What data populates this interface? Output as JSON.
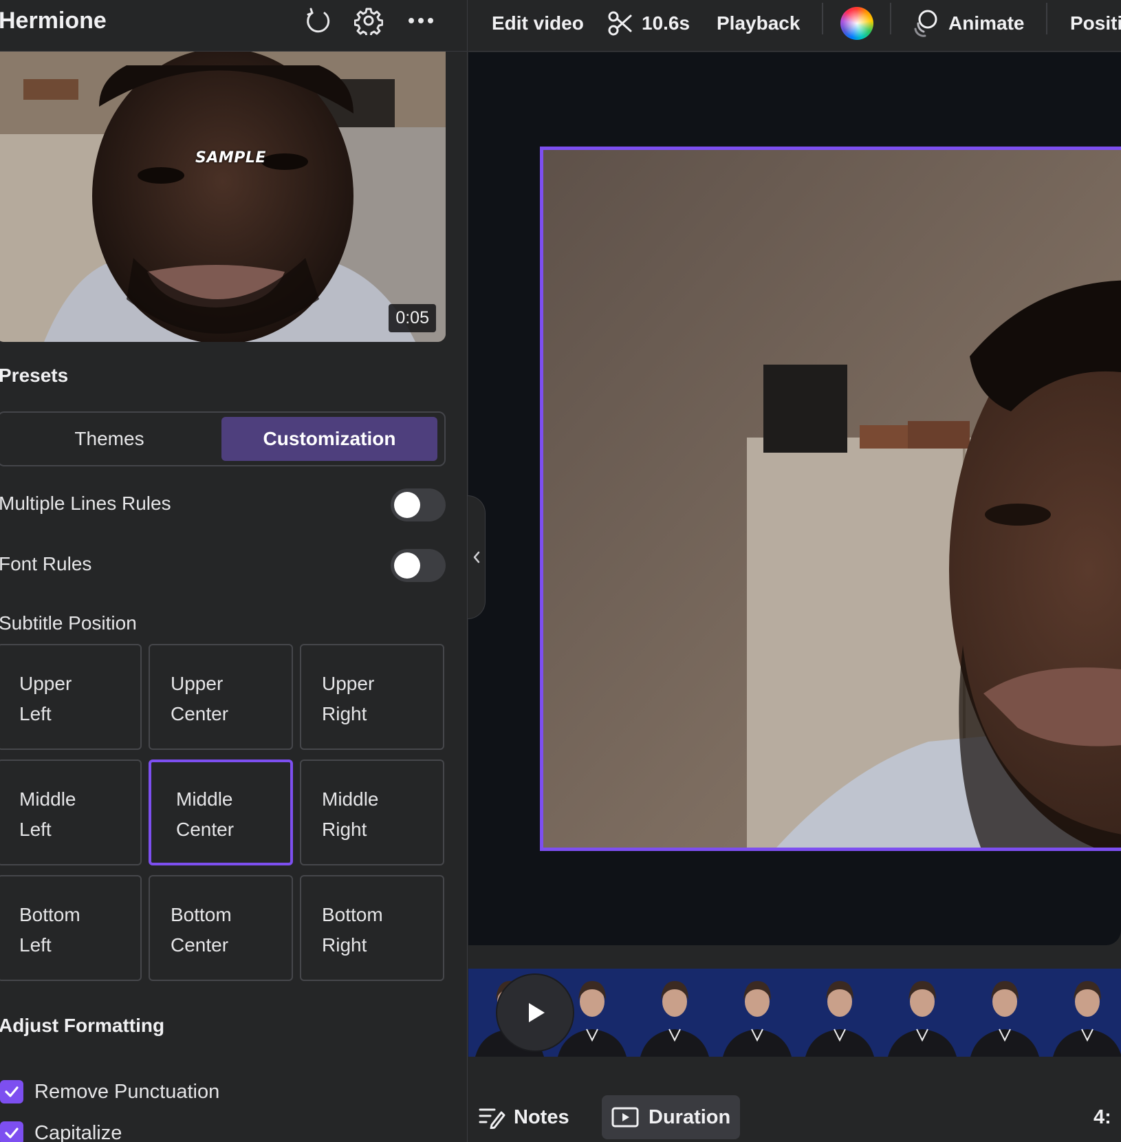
{
  "panel": {
    "title": "Hermione",
    "preview": {
      "overlay_text": "SAMPLE",
      "timestamp": "0:05"
    },
    "presets_heading": "Presets",
    "tabs": [
      {
        "label": "Themes",
        "selected": false
      },
      {
        "label": "Customization",
        "selected": true
      }
    ],
    "toggles": [
      {
        "label": "Multiple Lines Rules",
        "on": false
      },
      {
        "label": "Font Rules",
        "on": false
      }
    ],
    "subtitle_position": {
      "heading": "Subtitle Position",
      "selected": "Middle Center",
      "cells": [
        {
          "line1": "Upper",
          "line2": "Left"
        },
        {
          "line1": "Upper",
          "line2": "Center"
        },
        {
          "line1": "Upper",
          "line2": "Right"
        },
        {
          "line1": "Middle",
          "line2": "Left"
        },
        {
          "line1": "Middle",
          "line2": "Center"
        },
        {
          "line1": "Middle",
          "line2": "Right"
        },
        {
          "line1": "Bottom",
          "line2": "Left"
        },
        {
          "line1": "Bottom",
          "line2": "Center"
        },
        {
          "line1": "Bottom",
          "line2": "Right"
        }
      ]
    },
    "formatting": {
      "heading": "Adjust Formatting",
      "options": [
        {
          "label": "Remove Punctuation",
          "checked": true
        },
        {
          "label": "Capitalize",
          "checked": true
        }
      ]
    }
  },
  "toolbar": {
    "edit_video": "Edit video",
    "duration": "10.6s",
    "playback": "Playback",
    "animate": "Animate",
    "position": "Positi"
  },
  "bottom_bar": {
    "notes": "Notes",
    "duration": "Duration",
    "time": "4:"
  },
  "colors": {
    "accent": "#7d4ff0",
    "selected_tab": "#4e3f7d",
    "panel_bg": "#252627",
    "canvas_bg": "#0f1217",
    "timeline_bg": "#16296a"
  },
  "icons": [
    "refresh-icon",
    "gear-icon",
    "more-icon",
    "scissors-icon",
    "color-wheel-icon",
    "animate-icon",
    "chevron-left-icon",
    "play-icon",
    "notes-icon",
    "duration-icon",
    "checkmark-icon"
  ]
}
